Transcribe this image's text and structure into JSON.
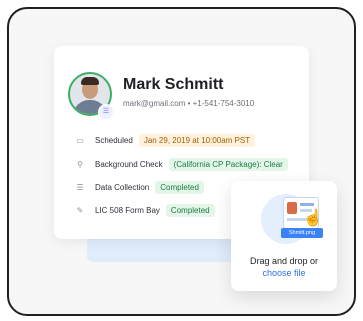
{
  "profile": {
    "name": "Mark Schmitt",
    "contact": "mark@gmail.com • +1-541-754-3010",
    "avatar_badge_icon": "list-icon"
  },
  "rows": [
    {
      "icon": "calendar-icon",
      "icon_glyph": "▭",
      "label": "Scheduled",
      "value": "Jan 29, 2019 at 10:00am PST",
      "color": "orange"
    },
    {
      "icon": "search-icon",
      "icon_glyph": "⚲",
      "label": "Background Check",
      "value": "(California CP Package): Clear",
      "color": "green"
    },
    {
      "icon": "list-icon",
      "icon_glyph": "☰",
      "label": "Data Collection",
      "value": "Completed",
      "color": "green"
    },
    {
      "icon": "pen-icon",
      "icon_glyph": "✎",
      "label": "LIC 508 Form Bay",
      "value": "Completed",
      "color": "green"
    }
  ],
  "upload": {
    "file_name": "Shmitt.png",
    "drag_text": "Drag and drop or",
    "choose_text": "choose file",
    "pointer_icon": "hand-pointer-icon"
  },
  "colors": {
    "accent_green": "#3cae63",
    "link_blue": "#2f6fed",
    "scheduled_pill_bg": "#fff1dc",
    "completed_pill_bg": "#e3f6e8"
  }
}
